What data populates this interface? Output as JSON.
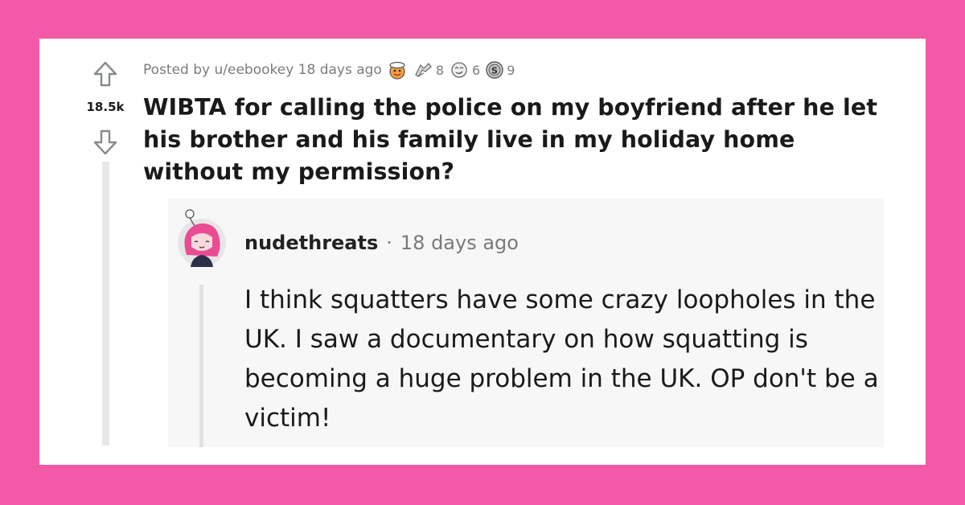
{
  "post": {
    "score": "18.5k",
    "posted_by": "Posted by u/eebookey 18 days ago",
    "awards": [
      {
        "name": "wholesome-award-icon",
        "count": ""
      },
      {
        "name": "helpful-award-icon",
        "count": "8"
      },
      {
        "name": "silver-award-icon",
        "count": "6"
      },
      {
        "name": "gold-award-icon",
        "count": "9"
      }
    ],
    "title": "WIBTA for calling the police on my boyfriend after he let his brother and his family live in my holiday home without my permission?"
  },
  "comment": {
    "username": "nudethreats",
    "separator": "·",
    "time": "18 days ago",
    "body": "I think squatters have some crazy loopholes in the UK. I saw a documentary on how squatting is becoming a huge problem in the UK. OP don't be a victim!"
  },
  "colors": {
    "background": "#f25aa8",
    "card": "#ffffff",
    "comment_bg": "#f7f7f7",
    "avatar_hair": "#e84d93"
  }
}
